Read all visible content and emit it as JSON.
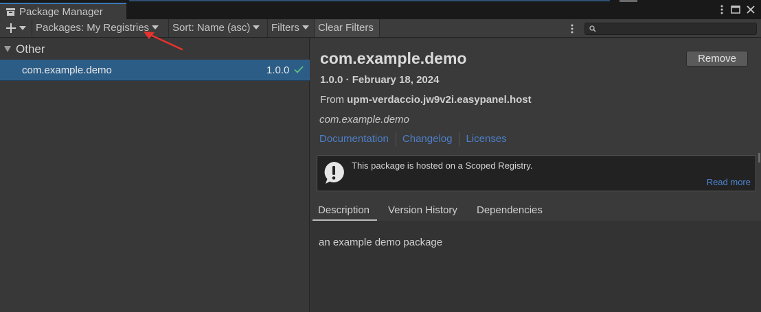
{
  "window": {
    "title": "Package Manager"
  },
  "toolbar": {
    "packages_filter": "Packages: My Registries",
    "sort": "Sort: Name (asc)",
    "filters": "Filters",
    "clear_filters": "Clear Filters",
    "search_value": ""
  },
  "list": {
    "group": "Other",
    "items": [
      {
        "name": "com.example.demo",
        "version": "1.0.0",
        "status": "installed"
      }
    ]
  },
  "details": {
    "title": "com.example.demo",
    "version_date": "1.0.0 · February 18, 2024",
    "from_label": "From",
    "registry": "upm-verdaccio.jw9v2i.easypanel.host",
    "package_id": "com.example.demo",
    "links": [
      "Documentation",
      "Changelog",
      "Licenses"
    ],
    "remove_label": "Remove",
    "notice": "This package is hosted on a Scoped Registry.",
    "read_more": "Read more",
    "tabs": [
      "Description",
      "Version History",
      "Dependencies"
    ],
    "active_tab": "Description",
    "description": "an example demo package"
  },
  "colors": {
    "selection": "#2c5d87",
    "link": "#4d7fc9",
    "accent_tab": "#3a79bb",
    "annotation_arrow": "#e8322e",
    "check": "#5fbf7f"
  }
}
